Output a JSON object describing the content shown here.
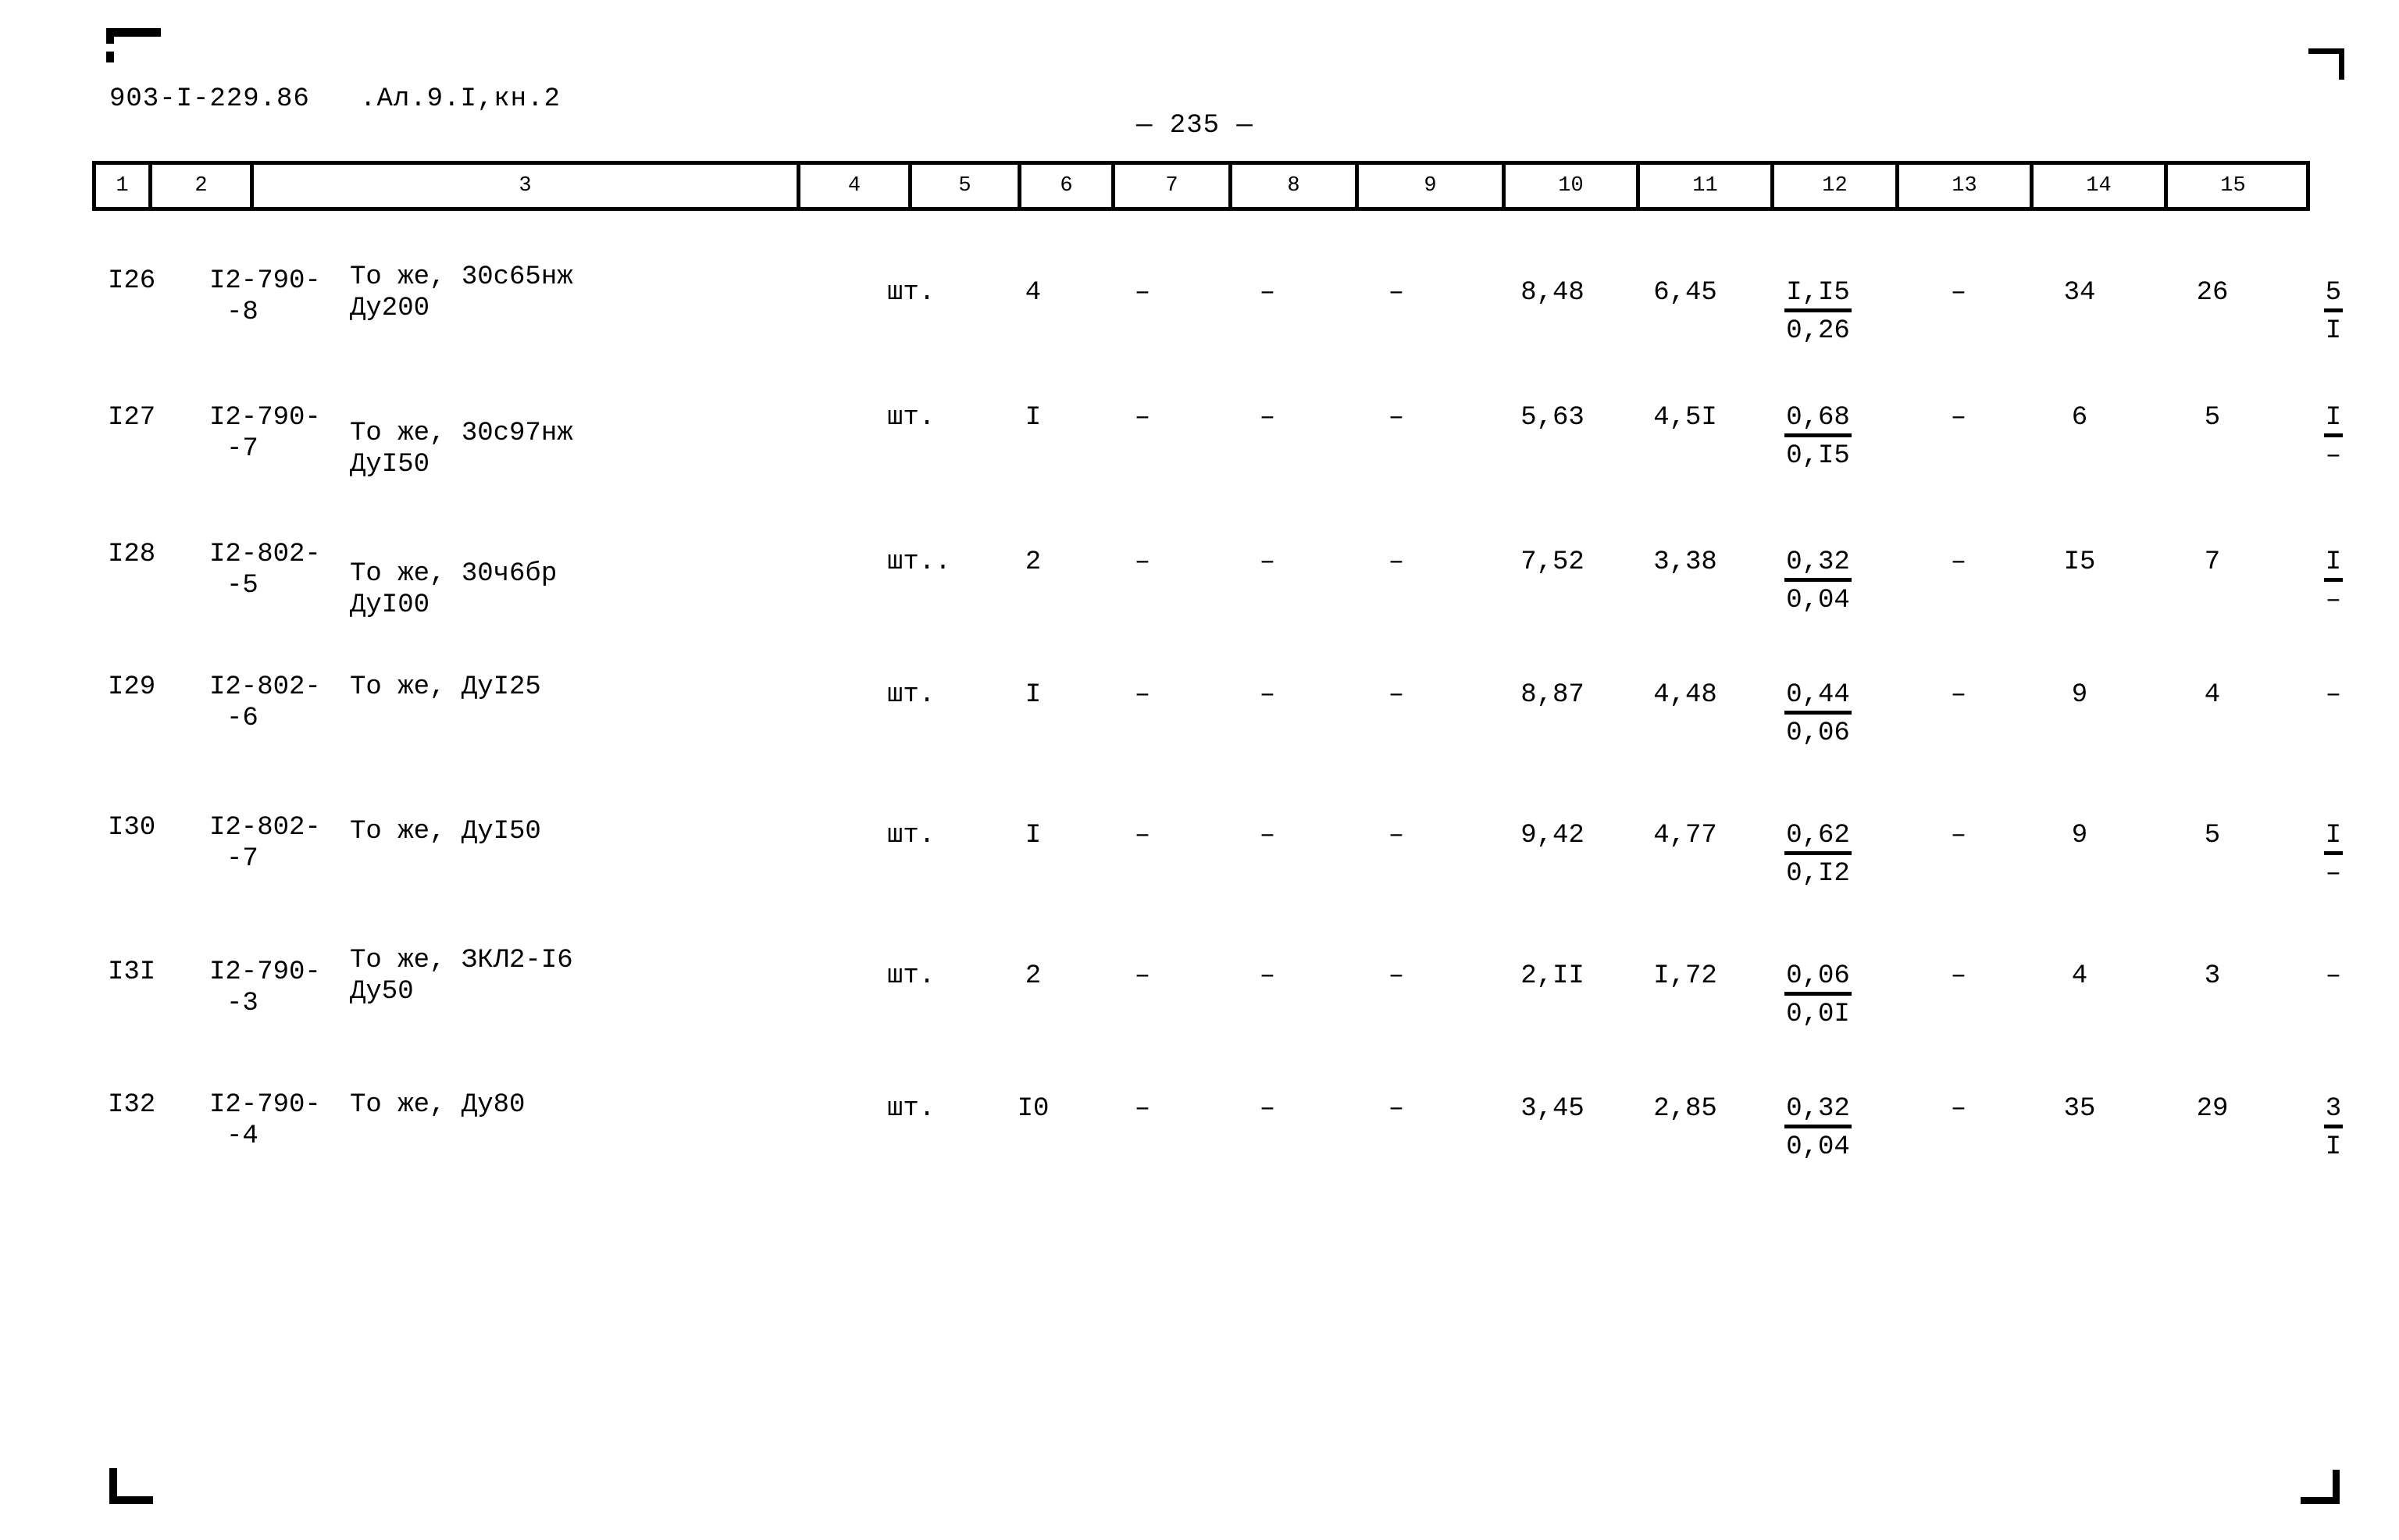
{
  "document": {
    "code_line": "903-I-229.86   .Ал.9.I,кн.2",
    "page_marker": "— 235 —"
  },
  "table": {
    "column_headers": [
      "1",
      "2",
      "3",
      "4",
      "5",
      "6",
      "7",
      "8",
      "9",
      "10",
      "11",
      "12",
      "13",
      "14",
      "15"
    ],
    "rows": [
      {
        "c1": "I26",
        "c2_line1": "I2-790-",
        "c2_line2": "-8",
        "c3_line1": "То же, 30с65нж",
        "c3_line2": "Ду200",
        "c4": "шт.",
        "c5": "4",
        "c6": "–",
        "c7": "–",
        "c8": "–",
        "c9": "8,48",
        "c10": "6,45",
        "c11_num": "I,I5",
        "c11_den": "0,26",
        "c12": "–",
        "c13": "34",
        "c14": "26",
        "c15_num": "5",
        "c15_den": "I"
      },
      {
        "c1": "I27",
        "c2_line1": "I2-790-",
        "c2_line2": "-7",
        "c3_line1": "То же, 30с97нж",
        "c3_line2": "ДуI50",
        "c4": "шт.",
        "c5": "I",
        "c6": "–",
        "c7": "–",
        "c8": "–",
        "c9": "5,63",
        "c10": "4,5I",
        "c11_num": "0,68",
        "c11_den": "0,I5",
        "c12": "–",
        "c13": "6",
        "c14": "5",
        "c15_num": "I",
        "c15_den": "–"
      },
      {
        "c1": "I28",
        "c2_line1": "I2-802-",
        "c2_line2": "-5",
        "c3_line1": "То же, 30ч6бр",
        "c3_line2": "ДуI00",
        "c4": "шт..",
        "c5": "2",
        "c6": "–",
        "c7": "–",
        "c8": "–",
        "c9": "7,52",
        "c10": "3,38",
        "c11_num": "0,32",
        "c11_den": "0,04",
        "c12": "–",
        "c13": "I5",
        "c14": "7",
        "c15_num": "I",
        "c15_den": "–"
      },
      {
        "c1": "I29",
        "c2_line1": "I2-802-",
        "c2_line2": "-6",
        "c3_line1": "То же, ДуI25",
        "c3_line2": "",
        "c4": "шт.",
        "c5": "I",
        "c6": "–",
        "c7": "–",
        "c8": "–",
        "c9": "8,87",
        "c10": "4,48",
        "c11_num": "0,44",
        "c11_den": "0,06",
        "c12": "–",
        "c13": "9",
        "c14": "4",
        "c15_num": "–",
        "c15_den": ""
      },
      {
        "c1": "I30",
        "c2_line1": "I2-802-",
        "c2_line2": "-7",
        "c3_line1": "То же, ДуI50",
        "c3_line2": "",
        "c4": "шт.",
        "c5": "I",
        "c6": "–",
        "c7": "–",
        "c8": "–",
        "c9": "9,42",
        "c10": "4,77",
        "c11_num": "0,62",
        "c11_den": "0,I2",
        "c12": "–",
        "c13": "9",
        "c14": "5",
        "c15_num": "I",
        "c15_den": "–"
      },
      {
        "c1": "I3I",
        "c2_line1": "I2-790-",
        "c2_line2": "-3",
        "c3_line1": "То же, ЗКЛ2-I6",
        "c3_line2": "Ду50",
        "c4": "шт.",
        "c5": "2",
        "c6": "–",
        "c7": "–",
        "c8": "–",
        "c9": "2,II",
        "c10": "I,72",
        "c11_num": "0,06",
        "c11_den": "0,0I",
        "c12": "–",
        "c13": "4",
        "c14": "3",
        "c15_num": "–",
        "c15_den": ""
      },
      {
        "c1": "I32",
        "c2_line1": "I2-790-",
        "c2_line2": "-4",
        "c3_line1": "То же, Ду80",
        "c3_line2": "",
        "c4": "шт.",
        "c5": "I0",
        "c6": "–",
        "c7": "–",
        "c8": "–",
        "c9": "3,45",
        "c10": "2,85",
        "c11_num": "0,32",
        "c11_den": "0,04",
        "c12": "–",
        "c13": "35",
        "c14": "29",
        "c15_num": "3",
        "c15_den": "I"
      }
    ]
  }
}
